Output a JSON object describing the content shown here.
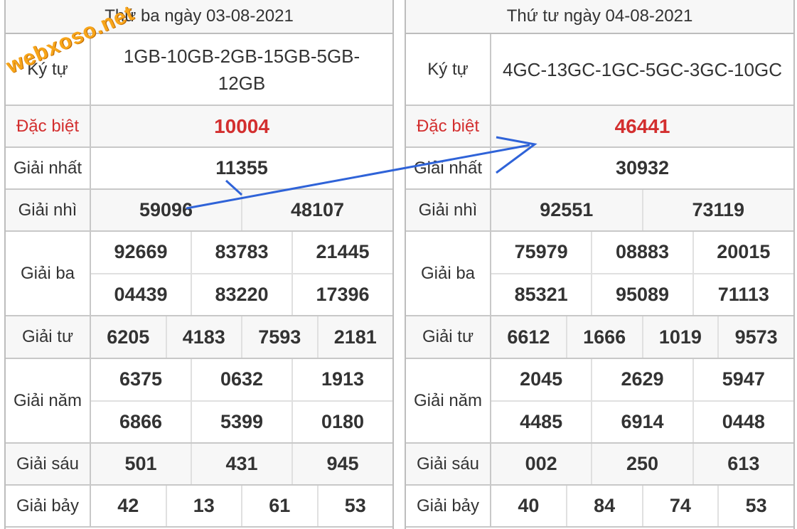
{
  "watermark": "webxoso.net",
  "left": {
    "header": "Thứ ba ngày 03-08-2021",
    "kytu_label": "Ký tự",
    "kytu_value": "1GB-10GB-2GB-15GB-5GB-12GB",
    "rows": [
      {
        "label": "Đặc biệt",
        "lines": [
          [
            "10004"
          ]
        ]
      },
      {
        "label": "Giải nhất",
        "lines": [
          [
            "11355"
          ]
        ]
      },
      {
        "label": "Giải nhì",
        "lines": [
          [
            "59096",
            "48107"
          ]
        ]
      },
      {
        "label": "Giải ba",
        "lines": [
          [
            "92669",
            "83783",
            "21445"
          ],
          [
            "04439",
            "83220",
            "17396"
          ]
        ]
      },
      {
        "label": "Giải tư",
        "lines": [
          [
            "6205",
            "4183",
            "7593",
            "2181"
          ]
        ]
      },
      {
        "label": "Giải năm",
        "lines": [
          [
            "6375",
            "0632",
            "1913"
          ],
          [
            "6866",
            "5399",
            "0180"
          ]
        ]
      },
      {
        "label": "Giải sáu",
        "lines": [
          [
            "501",
            "431",
            "945"
          ]
        ]
      },
      {
        "label": "Giải bảy",
        "lines": [
          [
            "42",
            "13",
            "61",
            "53"
          ]
        ]
      }
    ]
  },
  "right": {
    "header": "Thứ tư ngày 04-08-2021",
    "kytu_label": "Ký tự",
    "kytu_value": "4GC-13GC-1GC-5GC-3GC-10GC",
    "rows": [
      {
        "label": "Đặc biệt",
        "lines": [
          [
            "46441"
          ]
        ]
      },
      {
        "label": "Giải nhất",
        "lines": [
          [
            "30932"
          ]
        ]
      },
      {
        "label": "Giải nhì",
        "lines": [
          [
            "92551",
            "73119"
          ]
        ]
      },
      {
        "label": "Giải ba",
        "lines": [
          [
            "75979",
            "08883",
            "20015"
          ],
          [
            "85321",
            "95089",
            "71113"
          ]
        ]
      },
      {
        "label": "Giải tư",
        "lines": [
          [
            "6612",
            "1666",
            "1019",
            "9573"
          ]
        ]
      },
      {
        "label": "Giải năm",
        "lines": [
          [
            "2045",
            "2629",
            "5947"
          ],
          [
            "4485",
            "6914",
            "0448"
          ]
        ]
      },
      {
        "label": "Giải sáu",
        "lines": [
          [
            "002",
            "250",
            "613"
          ]
        ]
      },
      {
        "label": "Giải bảy",
        "lines": [
          [
            "40",
            "84",
            "74",
            "53"
          ]
        ]
      }
    ]
  },
  "colors": {
    "special": "#d32f2f",
    "highlight": "#3c6ee6",
    "arrow": "#2f63d8",
    "watermark": "#f7a51a"
  }
}
